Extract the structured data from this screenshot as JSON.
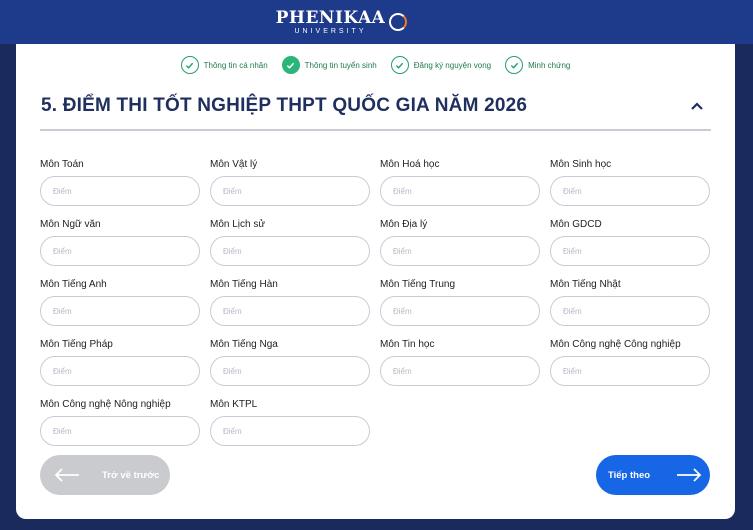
{
  "brand": {
    "name": "PHENIKAA",
    "subtitle": "UNIVERSITY"
  },
  "steps": [
    {
      "label": "Thông tin cá nhân",
      "filled": false
    },
    {
      "label": "Thông tin tuyển sinh",
      "filled": true
    },
    {
      "label": "Đăng ký nguyện vọng",
      "filled": false
    },
    {
      "label": "Minh chứng",
      "filled": false
    }
  ],
  "section": {
    "title": "5. ĐIỂM THI TỐT NGHIỆP THPT QUỐC GIA NĂM 2026"
  },
  "fields": [
    {
      "label": "Môn Toán",
      "placeholder": "Điểm",
      "value": ""
    },
    {
      "label": "Môn Vật lý",
      "placeholder": "Điểm",
      "value": ""
    },
    {
      "label": "Môn Hoá học",
      "placeholder": "Điểm",
      "value": ""
    },
    {
      "label": "Môn Sinh học",
      "placeholder": "Điểm",
      "value": ""
    },
    {
      "label": "Môn Ngữ văn",
      "placeholder": "Điểm",
      "value": ""
    },
    {
      "label": "Môn Lịch sử",
      "placeholder": "Điểm",
      "value": ""
    },
    {
      "label": "Môn Địa lý",
      "placeholder": "Điểm",
      "value": ""
    },
    {
      "label": "Môn GDCD",
      "placeholder": "Điểm",
      "value": ""
    },
    {
      "label": "Môn Tiếng Anh",
      "placeholder": "Điểm",
      "value": ""
    },
    {
      "label": "Môn Tiếng Hàn",
      "placeholder": "Điểm",
      "value": ""
    },
    {
      "label": "Môn Tiếng Trung",
      "placeholder": "Điểm",
      "value": ""
    },
    {
      "label": "Môn Tiếng Nhật",
      "placeholder": "Điểm",
      "value": ""
    },
    {
      "label": "Môn Tiếng Pháp",
      "placeholder": "Điểm",
      "value": ""
    },
    {
      "label": "Môn Tiếng Nga",
      "placeholder": "Điểm",
      "value": ""
    },
    {
      "label": "Môn Tin học",
      "placeholder": "Điểm",
      "value": ""
    },
    {
      "label": "Môn Công nghệ Công nghiệp",
      "placeholder": "Điểm",
      "value": ""
    },
    {
      "label": "Môn Công nghệ Nông nghiệp",
      "placeholder": "Điểm",
      "value": ""
    },
    {
      "label": "Môn KTPL",
      "placeholder": "Điểm",
      "value": ""
    }
  ],
  "buttons": {
    "back": "Trở về trước",
    "next": "Tiếp theo"
  },
  "colors": {
    "header": "#1e3a8a",
    "primary": "#1666e5",
    "success": "#2bb57a",
    "title": "#1f2f5e"
  }
}
